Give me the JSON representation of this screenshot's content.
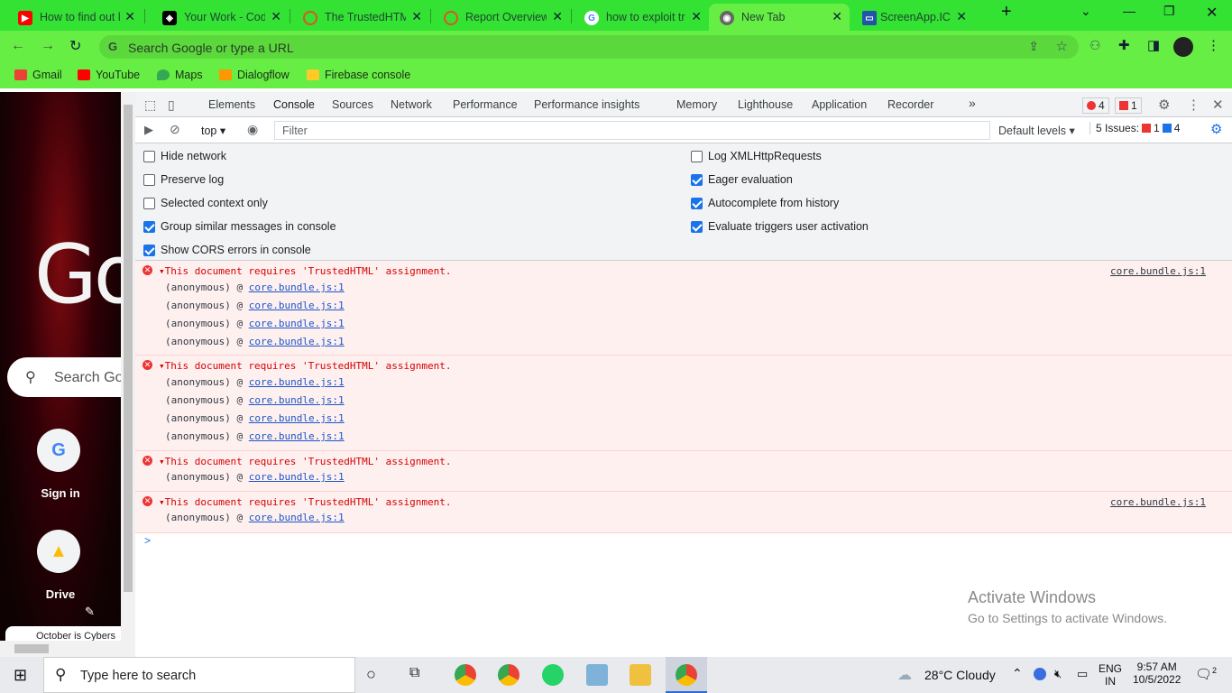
{
  "browser": {
    "tabs": [
      {
        "title": "How to find out l",
        "icon": "youtube-icon",
        "color": "#ff0000"
      },
      {
        "title": "Your Work - Cod",
        "icon": "codepen-icon",
        "color": "#000000"
      },
      {
        "title": "The TrustedHTML",
        "icon": "loading-icon",
        "color": "#dd5522"
      },
      {
        "title": "Report Overview",
        "icon": "loading-icon",
        "color": "#dd5522"
      },
      {
        "title": "how to exploit tr",
        "icon": "google-icon",
        "color": "#4285f4"
      },
      {
        "title": "New Tab",
        "icon": "chrome-icon",
        "color": "#555555",
        "active": true
      },
      {
        "title": "ScreenApp.IC",
        "icon": "screen-icon",
        "color": "#2255aa"
      }
    ],
    "new_tab": "+",
    "omnibox_placeholder": "Search Google or type a URL",
    "bookmarks": [
      {
        "label": "Gmail",
        "color": "#ea4335"
      },
      {
        "label": "YouTube",
        "color": "#ff0000"
      },
      {
        "label": "Maps",
        "color": "#34a853"
      },
      {
        "label": "Dialogflow",
        "color": "#ff9800"
      },
      {
        "label": "Firebase console",
        "color": "#ffca28"
      }
    ]
  },
  "newtab": {
    "logo_text": "Go",
    "search_placeholder": "Search Go",
    "shortcuts": [
      {
        "label": "Sign in"
      },
      {
        "label": "Drive"
      }
    ],
    "notice": "October is Cybers"
  },
  "devtools": {
    "tabs": [
      "Elements",
      "Console",
      "Sources",
      "Network",
      "Performance",
      "Performance insights",
      "Memory",
      "Lighthouse",
      "Application",
      "Recorder"
    ],
    "active_tab": "Console",
    "more": "»",
    "error_count": "4",
    "issue_count": "1",
    "context": "top",
    "filter_placeholder": "Filter",
    "levels": "Default levels",
    "issues_label": "5 Issues:",
    "issues_err": "1",
    "issues_info": "4",
    "settings_left": [
      {
        "label": "Hide network",
        "checked": false
      },
      {
        "label": "Preserve log",
        "checked": false
      },
      {
        "label": "Selected context only",
        "checked": false
      },
      {
        "label": "Group similar messages in console",
        "checked": true
      },
      {
        "label": "Show CORS errors in console",
        "checked": true
      }
    ],
    "settings_right": [
      {
        "label": "Log XMLHttpRequests",
        "checked": false
      },
      {
        "label": "Eager evaluation",
        "checked": true
      },
      {
        "label": "Autocomplete from history",
        "checked": true
      },
      {
        "label": "Evaluate triggers user activation",
        "checked": true
      }
    ],
    "messages": [
      {
        "text": "This document requires 'TrustedHTML' assignment.",
        "source": "core.bundle.js:1",
        "frames": 4
      },
      {
        "text": "This document requires 'TrustedHTML' assignment.",
        "source": "",
        "frames": 4
      },
      {
        "text": "This document requires 'TrustedHTML' assignment.",
        "source": "",
        "frames": 1
      },
      {
        "text": "This document requires 'TrustedHTML' assignment.",
        "source": "core.bundle.js:1",
        "frames": 1
      }
    ],
    "frame_prefix": "(anonymous) @ ",
    "frame_link": "core.bundle.js:1",
    "prompt": ">"
  },
  "watermark": {
    "line1": "Activate Windows",
    "line2": "Go to Settings to activate Windows."
  },
  "taskbar": {
    "search_placeholder": "Type here to search",
    "weather": "28°C  Cloudy",
    "lang1": "ENG",
    "lang2": "IN",
    "time": "9:57 AM",
    "date": "10/5/2022",
    "notif": "2"
  }
}
